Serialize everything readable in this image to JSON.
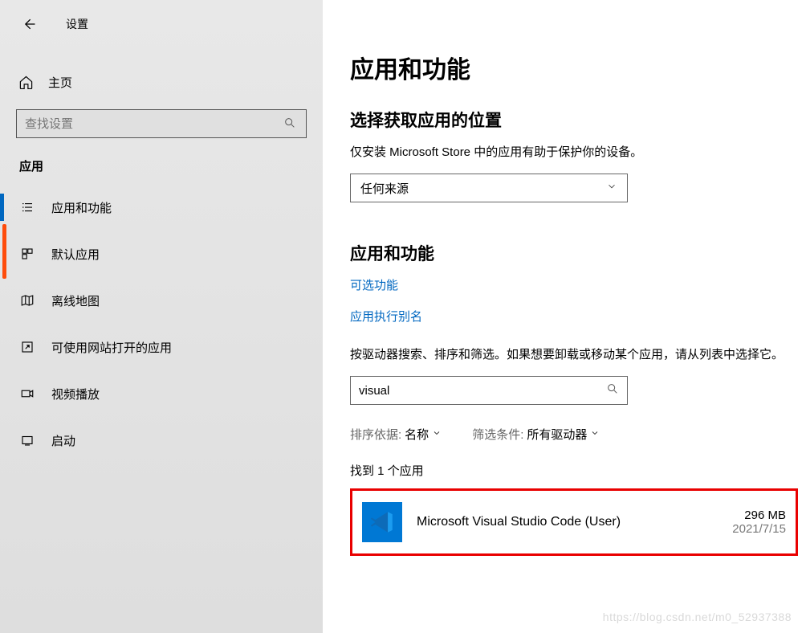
{
  "header": {
    "settings_title": "设置"
  },
  "sidebar": {
    "home_label": "主页",
    "search_placeholder": "查找设置",
    "section_label": "应用",
    "items": [
      {
        "label": "应用和功能"
      },
      {
        "label": "默认应用"
      },
      {
        "label": "离线地图"
      },
      {
        "label": "可使用网站打开的应用"
      },
      {
        "label": "视频播放"
      },
      {
        "label": "启动"
      }
    ]
  },
  "main": {
    "page_title": "应用和功能",
    "install_source_title": "选择获取应用的位置",
    "install_source_desc": "仅安装 Microsoft Store 中的应用有助于保护你的设备。",
    "install_source_value": "任何来源",
    "apps_features_title": "应用和功能",
    "optional_features_link": "可选功能",
    "app_aliases_link": "应用执行别名",
    "search_desc": "按驱动器搜索、排序和筛选。如果想要卸载或移动某个应用，请从列表中选择它。",
    "search_value": "visual",
    "sort_label": "排序依据:",
    "sort_value": "名称",
    "filter_label": "筛选条件:",
    "filter_value": "所有驱动器",
    "found_text": "找到 1 个应用",
    "app": {
      "name": "Microsoft Visual Studio Code (User)",
      "size": "296 MB",
      "date": "2021/7/15"
    }
  },
  "watermark": "https://blog.csdn.net/m0_52937388"
}
